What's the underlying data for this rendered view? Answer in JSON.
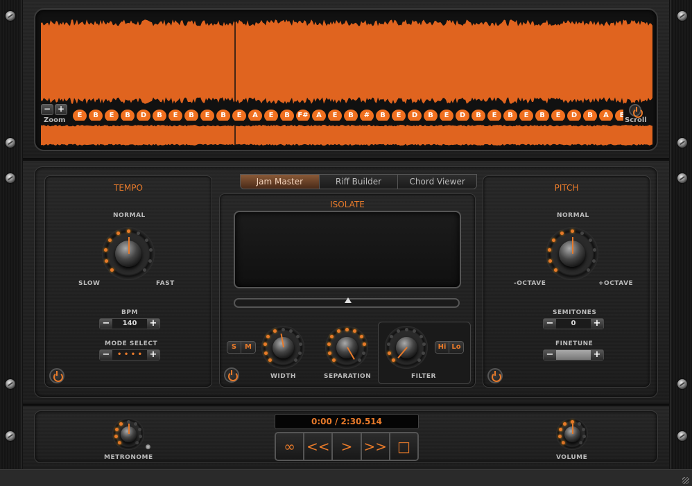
{
  "colors": {
    "accent": "#e87a2a",
    "waveform": "#e0641f",
    "panel_bg": "#222222"
  },
  "waveform": {
    "zoom_label": "Zoom",
    "zoom_out": "−",
    "zoom_in": "+",
    "scroll_label": "Scroll",
    "notes": [
      "E",
      "B",
      "E",
      "B",
      "D",
      "B",
      "E",
      "B",
      "E",
      "B",
      "E",
      "A",
      "E",
      "B",
      "F#",
      "A",
      "E",
      "B",
      "#",
      "B",
      "E",
      "D",
      "B",
      "E",
      "D",
      "B",
      "E",
      "B",
      "E",
      "B",
      "E",
      "D",
      "B",
      "A",
      "E",
      "B",
      "#",
      "A",
      "E",
      "B",
      "A",
      "B",
      "E",
      "B",
      "C#",
      "n",
      "F#",
      "B",
      "E",
      "B",
      "E",
      "B",
      "D",
      "B",
      "E",
      "B",
      "A",
      "B",
      "E",
      "B",
      "D",
      "A",
      "E",
      "B",
      "A",
      "E",
      "B",
      "F#"
    ]
  },
  "tabs": [
    {
      "label": "Jam Master",
      "active": true
    },
    {
      "label": "Riff Builder",
      "active": false
    },
    {
      "label": "Chord Viewer",
      "active": false
    }
  ],
  "tempo": {
    "title": "TEMPO",
    "top_label": "NORMAL",
    "left_label": "SLOW",
    "right_label": "FAST",
    "bpm_label": "BPM",
    "bpm_value": "140",
    "mode_label": "MODE SELECT",
    "mode_value": "• • • •",
    "minus": "−",
    "plus": "+"
  },
  "isolate": {
    "title": "ISOLATE",
    "solo_label": "S",
    "mute_label": "M",
    "width_label": "WIDTH",
    "separation_label": "SEPARATION",
    "filter_label": "FILTER",
    "hi_label": "Hi",
    "lo_label": "Lo",
    "slider_position": 0.5
  },
  "pitch": {
    "title": "PITCH",
    "top_label": "NORMAL",
    "left_label": "-OCTAVE",
    "right_label": "+OCTAVE",
    "semitones_label": "SEMITONES",
    "semitones_value": "0",
    "finetune_label": "FINETUNE",
    "finetune_value": "",
    "minus": "−",
    "plus": "+"
  },
  "transport": {
    "time": "0:00 / 2:30.514",
    "loop_icon": "∞",
    "rewind_label": "<<",
    "play_label": ">",
    "forward_label": ">>",
    "stop_label": "□",
    "metronome_label": "METRONOME",
    "volume_label": "VOLUME"
  }
}
